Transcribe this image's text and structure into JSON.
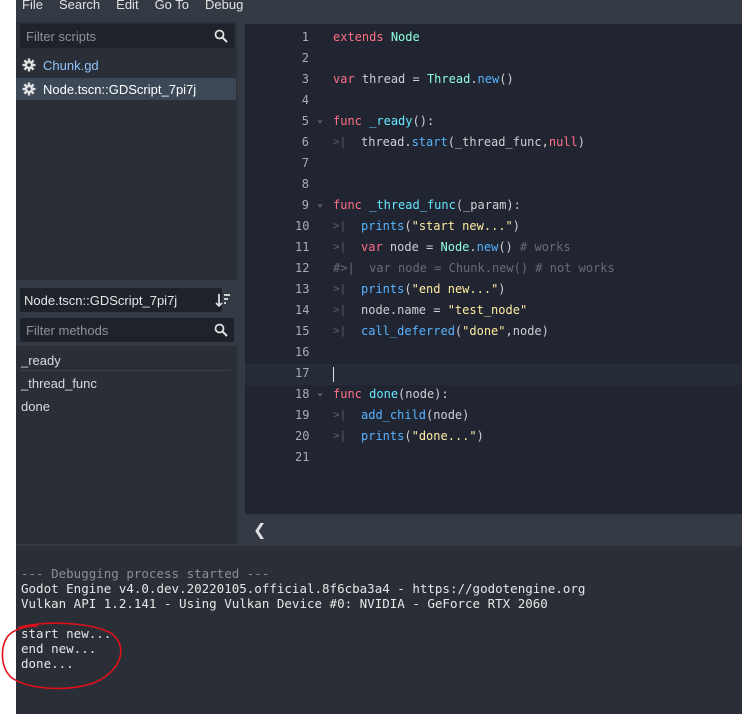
{
  "menu": [
    "File",
    "Search",
    "Edit",
    "Go To",
    "Debug"
  ],
  "script_filter": {
    "placeholder": "Filter scripts"
  },
  "scripts": [
    {
      "label": "Chunk.gd",
      "selected": false
    },
    {
      "label": "Node.tscn::GDScript_7pi7j",
      "selected": true
    }
  ],
  "current_script": "Node.tscn::GDScript_7pi7j",
  "method_filter": {
    "placeholder": "Filter methods"
  },
  "methods": [
    "_ready",
    "_thread_func",
    "done"
  ],
  "code_lines": [
    {
      "n": "1",
      "text": "extends Node"
    },
    {
      "n": "2",
      "text": ""
    },
    {
      "n": "3",
      "text": "var thread = Thread.new()"
    },
    {
      "n": "4",
      "text": ""
    },
    {
      "n": "5",
      "text": "func _ready():"
    },
    {
      "n": "6",
      "text": "thread.start(_thread_func,null)"
    },
    {
      "n": "7",
      "text": ""
    },
    {
      "n": "8",
      "text": ""
    },
    {
      "n": "9",
      "text": "func _thread_func(_param):"
    },
    {
      "n": "10",
      "text": "prints(\"start new...\")"
    },
    {
      "n": "11",
      "text": "var node = Node.new() # works"
    },
    {
      "n": "12",
      "text": "#  var node = Chunk.new() # not works"
    },
    {
      "n": "13",
      "text": "prints(\"end new...\")"
    },
    {
      "n": "14",
      "text": "node.name = \"test_node\""
    },
    {
      "n": "15",
      "text": "call_deferred(\"done\",node)"
    },
    {
      "n": "16",
      "text": ""
    },
    {
      "n": "17",
      "text": ""
    },
    {
      "n": "18",
      "text": "func done(node):"
    },
    {
      "n": "19",
      "text": "add_child(node)"
    },
    {
      "n": "20",
      "text": "prints(\"done...\")"
    },
    {
      "n": "21",
      "text": ""
    }
  ],
  "output": [
    "--- Debugging process started ---",
    "Godot Engine v4.0.dev.20220105.official.8f6cba3a4 - https://godotengine.org",
    "Vulkan API 1.2.141 - Using Vulkan Device #0: NVIDIA - GeForce RTX 2060",
    "",
    "start new...",
    "end new...",
    "done..."
  ],
  "icons": {
    "search": "search-icon",
    "gear": "gear-icon",
    "sort": "sort-icon",
    "collapse": "chevron-left-icon",
    "fold": "fold-arrow-icon",
    "tab": "tab-indent-icon"
  },
  "colors": {
    "keyword": "#ff7085",
    "type": "#8fffdb",
    "function": "#66e6ff",
    "string": "#ffeca1",
    "comment": "#676b72",
    "annotation": "#e0101a"
  }
}
